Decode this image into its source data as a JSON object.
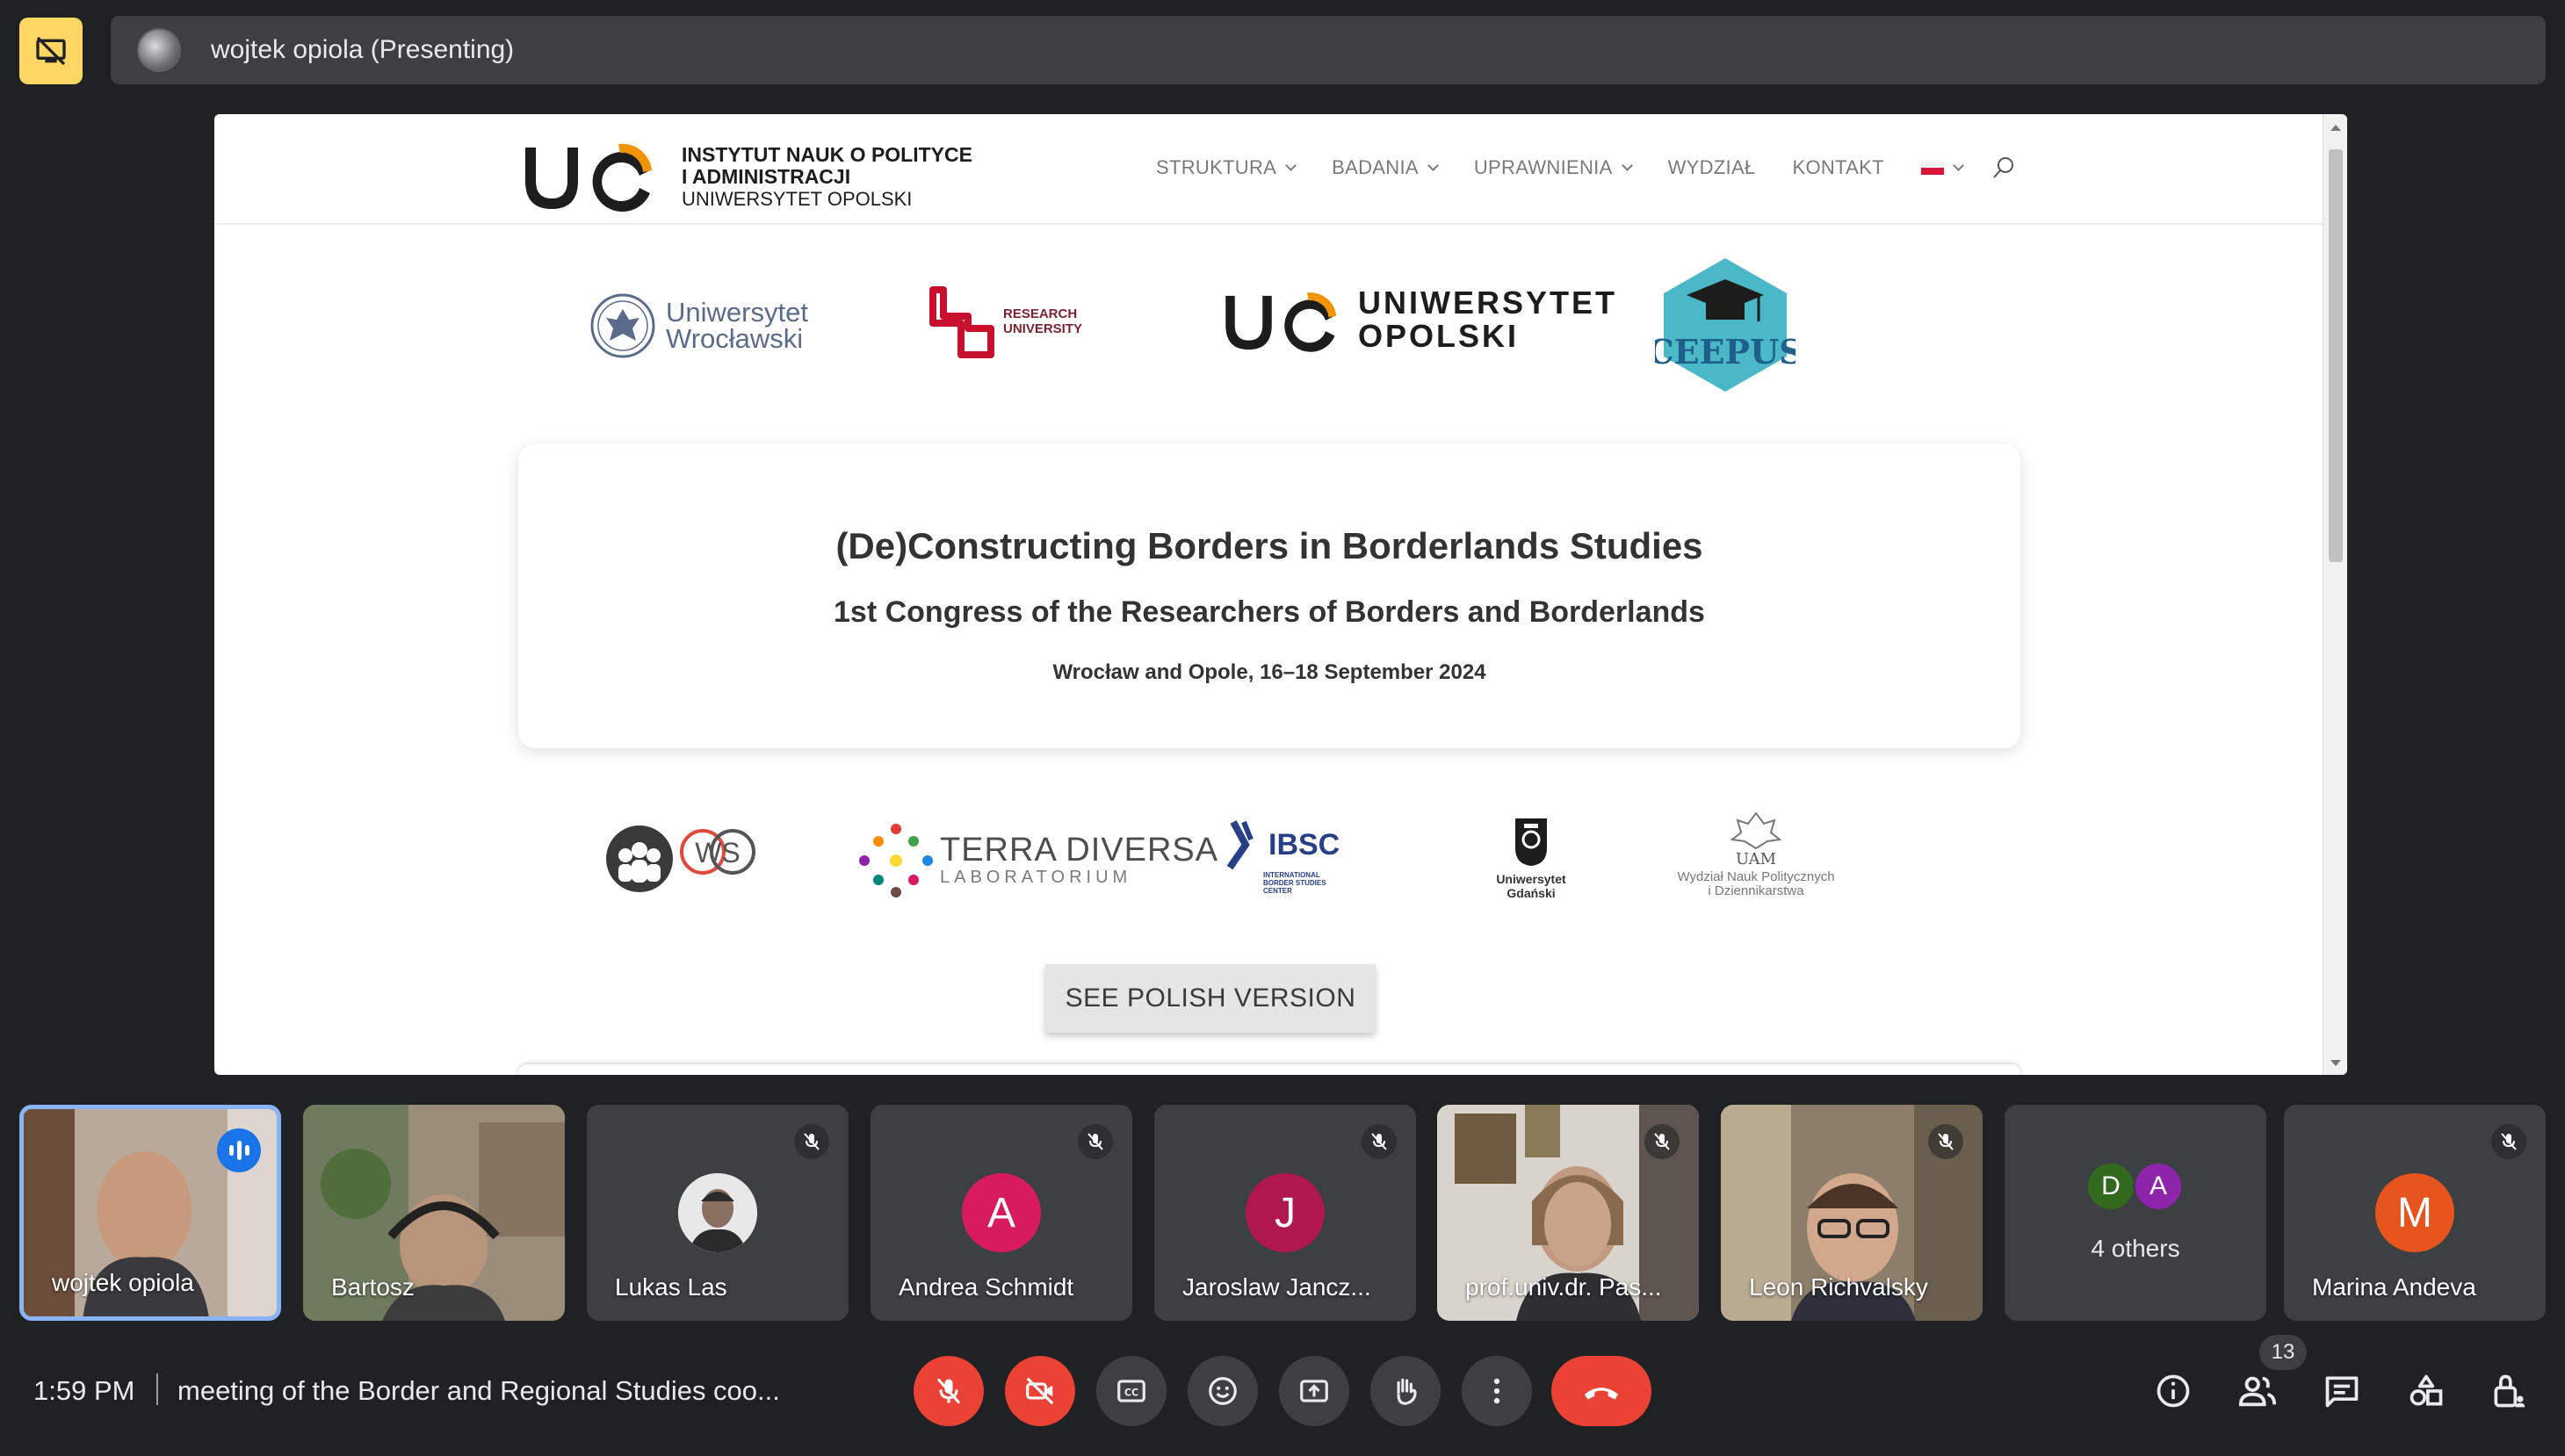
{
  "presenter": {
    "name_label": "wojtek opiola (Presenting)"
  },
  "shared_page": {
    "institute": {
      "line1": "INSTYTUT NAUK O POLITYCE",
      "line2": "I ADMINISTRACJI",
      "line3": "UNIWERSYTET OPOLSKI"
    },
    "nav": [
      "STRUKTURA",
      "BADANIA",
      "UPRAWNIENIA",
      "WYDZIAŁ",
      "KONTAKT"
    ],
    "logos": {
      "uwr_line1": "Uniwersytet",
      "uwr_line2": "Wrocławski",
      "ru_line1": "RESEARCH",
      "ru_line2": "UNIVERSITY",
      "uo_line1": "UNIWERSYTET",
      "uo_line2": "OPOLSKI",
      "ceepus": "CEEPUS"
    },
    "card": {
      "title": "(De)Constructing Borders in Borderlands Studies",
      "subtitle": "1st Congress of the Researchers of Borders and Borderlands",
      "date": "Wrocław and Opole, 16–18 September 2024"
    },
    "partners": {
      "ws": "WS",
      "terra_line1": "TERRA DIVERSA",
      "terra_line2": "LABORATORIUM",
      "ibsc": "IBSC",
      "ibsc_small1": "INTERNATIONAL",
      "ibsc_small2": "BORDER STUDIES",
      "ibsc_small3": "CENTER",
      "ug_line1": "Uniwersytet",
      "ug_line2": "Gdański",
      "uam_logo": "UAM",
      "uam_line1": "Wydział Nauk Politycznych",
      "uam_line2": "i Dziennikarstwa"
    },
    "polish_button": "SEE POLISH VERSION"
  },
  "participants": [
    {
      "name": "wojtek opiola",
      "type": "video",
      "speaking": true
    },
    {
      "name": "Bartosz",
      "type": "video"
    },
    {
      "name": "Lukas Las",
      "type": "photo",
      "muted": true
    },
    {
      "name": "Andrea Schmidt",
      "type": "letter",
      "letter": "A",
      "color": "#d81b60",
      "muted": true
    },
    {
      "name": "Jaroslaw Jancz...",
      "type": "letter",
      "letter": "J",
      "color": "#b0174e",
      "muted": true
    },
    {
      "name": "prof.univ.dr. Pas...",
      "type": "video",
      "muted": true
    },
    {
      "name": "Leon Richvalsky",
      "type": "video",
      "muted": true
    },
    {
      "name": "4 others",
      "type": "others",
      "letters": [
        "D",
        "A"
      ],
      "colors": [
        "#33691e",
        "#8e24aa"
      ]
    },
    {
      "name": "Marina Andeva",
      "type": "letter",
      "letter": "M",
      "color": "#e8541e",
      "muted": true
    }
  ],
  "bottom_bar": {
    "time": "1:59 PM",
    "meeting_title": "meeting of the Border and Regional Studies coo...",
    "people_count": "13"
  },
  "colors": {
    "accent_blue": "#8ab4f8",
    "hangup_red": "#ea4335",
    "present_yellow": "#fdd663"
  }
}
